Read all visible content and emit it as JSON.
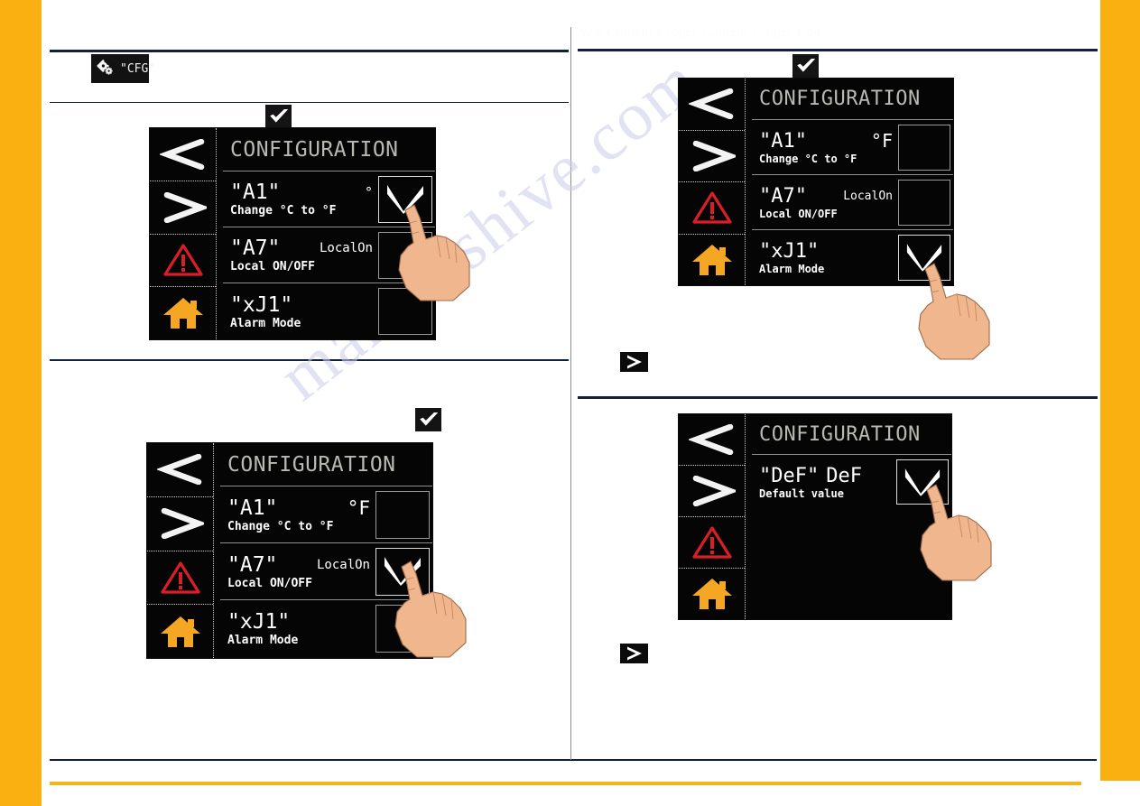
{
  "theme": {
    "accent_yellow": "#fbb012",
    "rule_navy": "#12203f",
    "screen_bg": "#050505",
    "screen_title_gray": "#b9b9b4",
    "alarm_red": "#d81f26",
    "home_orange": "#f5a623"
  },
  "watermark": {
    "text": "manualshive.com"
  },
  "faint_header": {
    "text": "New Content Croger Content Croger Con"
  },
  "cfg_pill": {
    "icon": "gears-icon",
    "label": "\"CFG\""
  },
  "badges": {
    "check": "check-icon",
    "next": "play-arrow-icon"
  },
  "sidebar_icons": [
    {
      "name": "prev-chevron-icon",
      "glyph": "<"
    },
    {
      "name": "next-chevron-icon",
      "glyph": ">"
    },
    {
      "name": "alarm-warning-icon",
      "glyph": "!"
    },
    {
      "name": "home-icon",
      "glyph": "home"
    }
  ],
  "panels": [
    {
      "id": "panel-step-1",
      "title": "CONFIGURATION",
      "rows": [
        {
          "code": "\"A1\"",
          "value": "°",
          "desc": "Change °C to °F",
          "checked": true
        },
        {
          "code": "\"A7\"",
          "value": "LocalOn",
          "desc": "Local ON/OFF",
          "checked": false
        },
        {
          "code": "\"xJ1\"",
          "value": "",
          "desc": "Alarm Mode",
          "checked": false
        }
      ]
    },
    {
      "id": "panel-step-2",
      "title": "CONFIGURATION",
      "rows": [
        {
          "code": "\"A1\"",
          "value": "°F",
          "desc": "Change °C to °F",
          "checked": false
        },
        {
          "code": "\"A7\"",
          "value": "LocalOn",
          "desc": "Local ON/OFF",
          "checked": true
        },
        {
          "code": "\"xJ1\"",
          "value": "",
          "desc": "Alarm Mode",
          "checked": false
        }
      ]
    },
    {
      "id": "panel-step-3",
      "title": "CONFIGURATION",
      "rows": [
        {
          "code": "\"A1\"",
          "value": "°F",
          "desc": "Change °C to °F",
          "checked": false
        },
        {
          "code": "\"A7\"",
          "value": "LocalOn",
          "desc": "Local ON/OFF",
          "checked": false
        },
        {
          "code": "\"xJ1\"",
          "value": "",
          "desc": "Alarm Mode",
          "checked": true
        }
      ]
    },
    {
      "id": "panel-step-4",
      "title": "CONFIGURATION",
      "rows": [
        {
          "code": "\"DeF\"",
          "value": "DeF",
          "desc": "Default value",
          "checked": true
        }
      ]
    }
  ]
}
